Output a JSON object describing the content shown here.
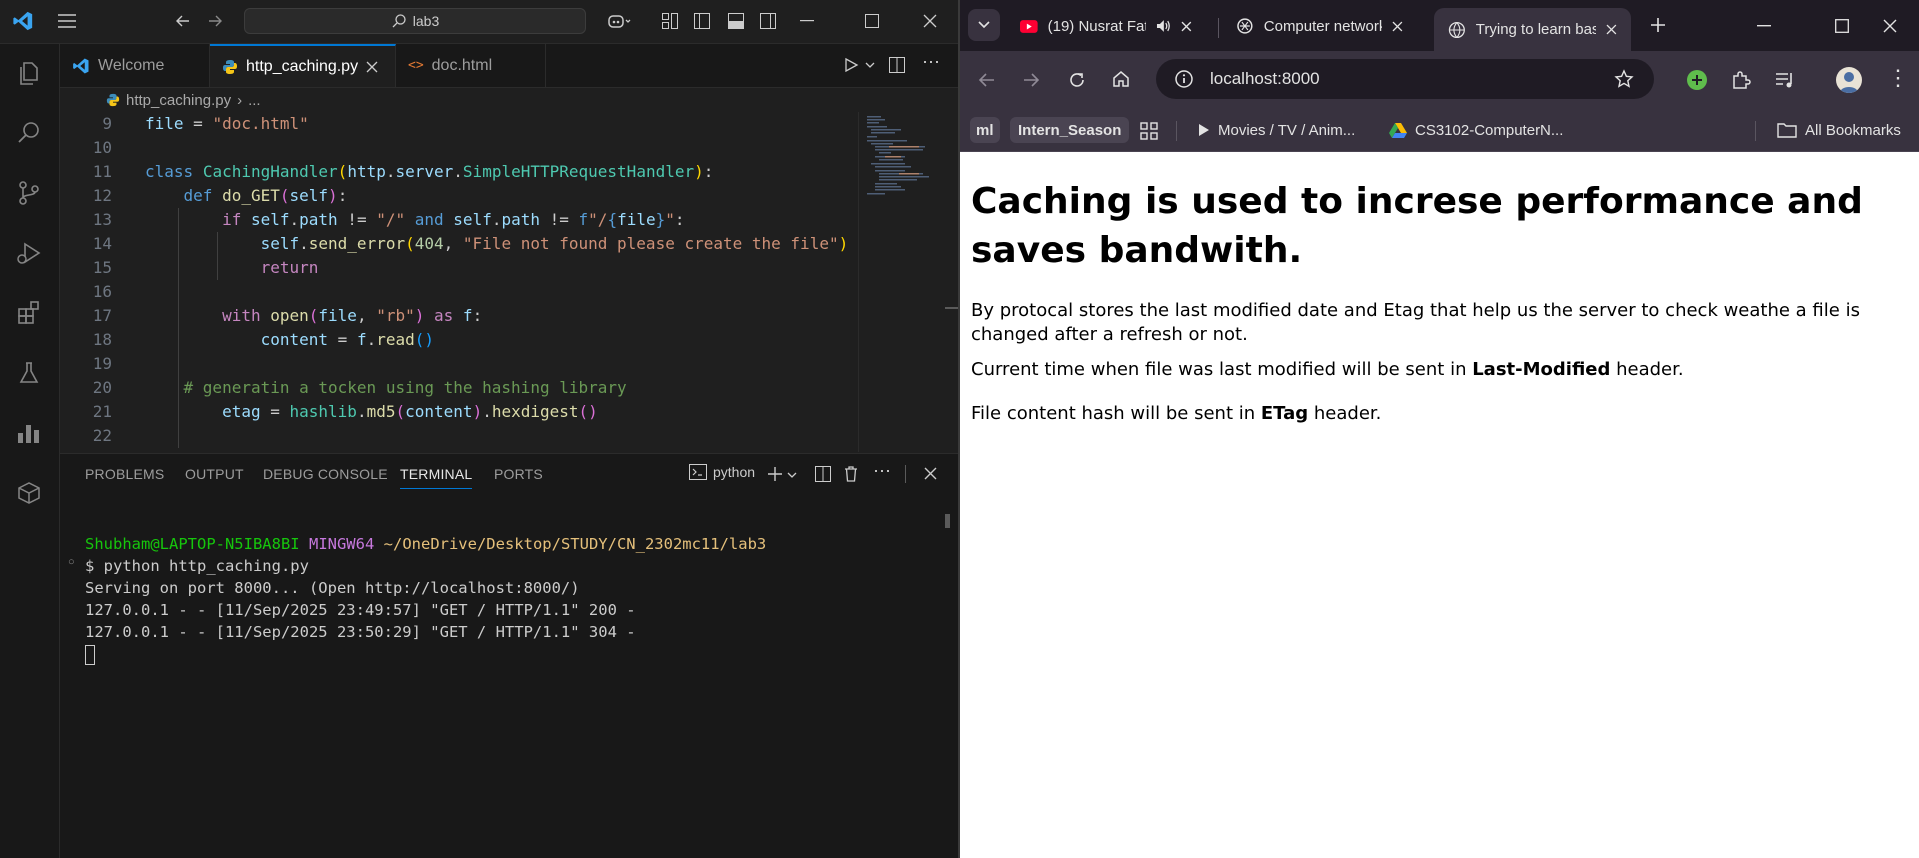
{
  "vscode": {
    "search_text": "lab3",
    "tabs": [
      {
        "label": "Welcome"
      },
      {
        "label": "http_caching.py"
      },
      {
        "label": "doc.html"
      }
    ],
    "breadcrumb": {
      "file": "http_caching.py",
      "rest": "..."
    },
    "code_lines": [
      "9",
      "10",
      "11",
      "12",
      "13",
      "14",
      "15",
      "16",
      "17",
      "18",
      "19",
      "20",
      "21",
      "22"
    ],
    "panel_tabs": [
      "PROBLEMS",
      "OUTPUT",
      "DEBUG CONSOLE",
      "TERMINAL",
      "PORTS"
    ],
    "terminal_name": "python",
    "terminal": {
      "user": "Shubham@LAPTOP-N5IBA8BI",
      "shell": "MINGW64",
      "path": "~/OneDrive/Desktop/STUDY/CN_2302mc11/lab3",
      "command": "$ python http_caching.py",
      "output": [
        "Serving on port 8000... (Open http://localhost:8000/)",
        "127.0.0.1 - - [11/Sep/2025 23:49:57] \"GET / HTTP/1.1\" 200 -",
        "127.0.0.1 - - [11/Sep/2025 23:50:29] \"GET / HTTP/1.1\" 304 -"
      ]
    }
  },
  "chrome": {
    "tabs": [
      {
        "label": "(19) Nusrat Fat"
      },
      {
        "label": "Computer network"
      },
      {
        "label": "Trying to learn bas"
      }
    ],
    "url": "localhost:8000",
    "bookmarks": {
      "ml": "ml",
      "intern": "Intern_Season",
      "movies": "Movies / TV / Anim...",
      "cs": "CS3102-ComputerN...",
      "all": "All Bookmarks"
    },
    "page": {
      "heading": "Caching is used to increse performance and saves bandwith.",
      "para1": "By protocal stores the last modified date and Etag that help us the server to check weathe a file is changed after a refresh or not.",
      "para2_pre": "Current time when file was last modified will be sent in ",
      "para2_bold": "Last-Modified",
      "para2_post": " header.",
      "para3_pre": "File content hash will be sent in ",
      "para3_bold": "ETag",
      "para3_post": " header."
    }
  },
  "colors": {
    "vscode_bg": "#1f1f1f",
    "accent_blue": "#0078d4",
    "chrome_frame": "#38323f"
  }
}
